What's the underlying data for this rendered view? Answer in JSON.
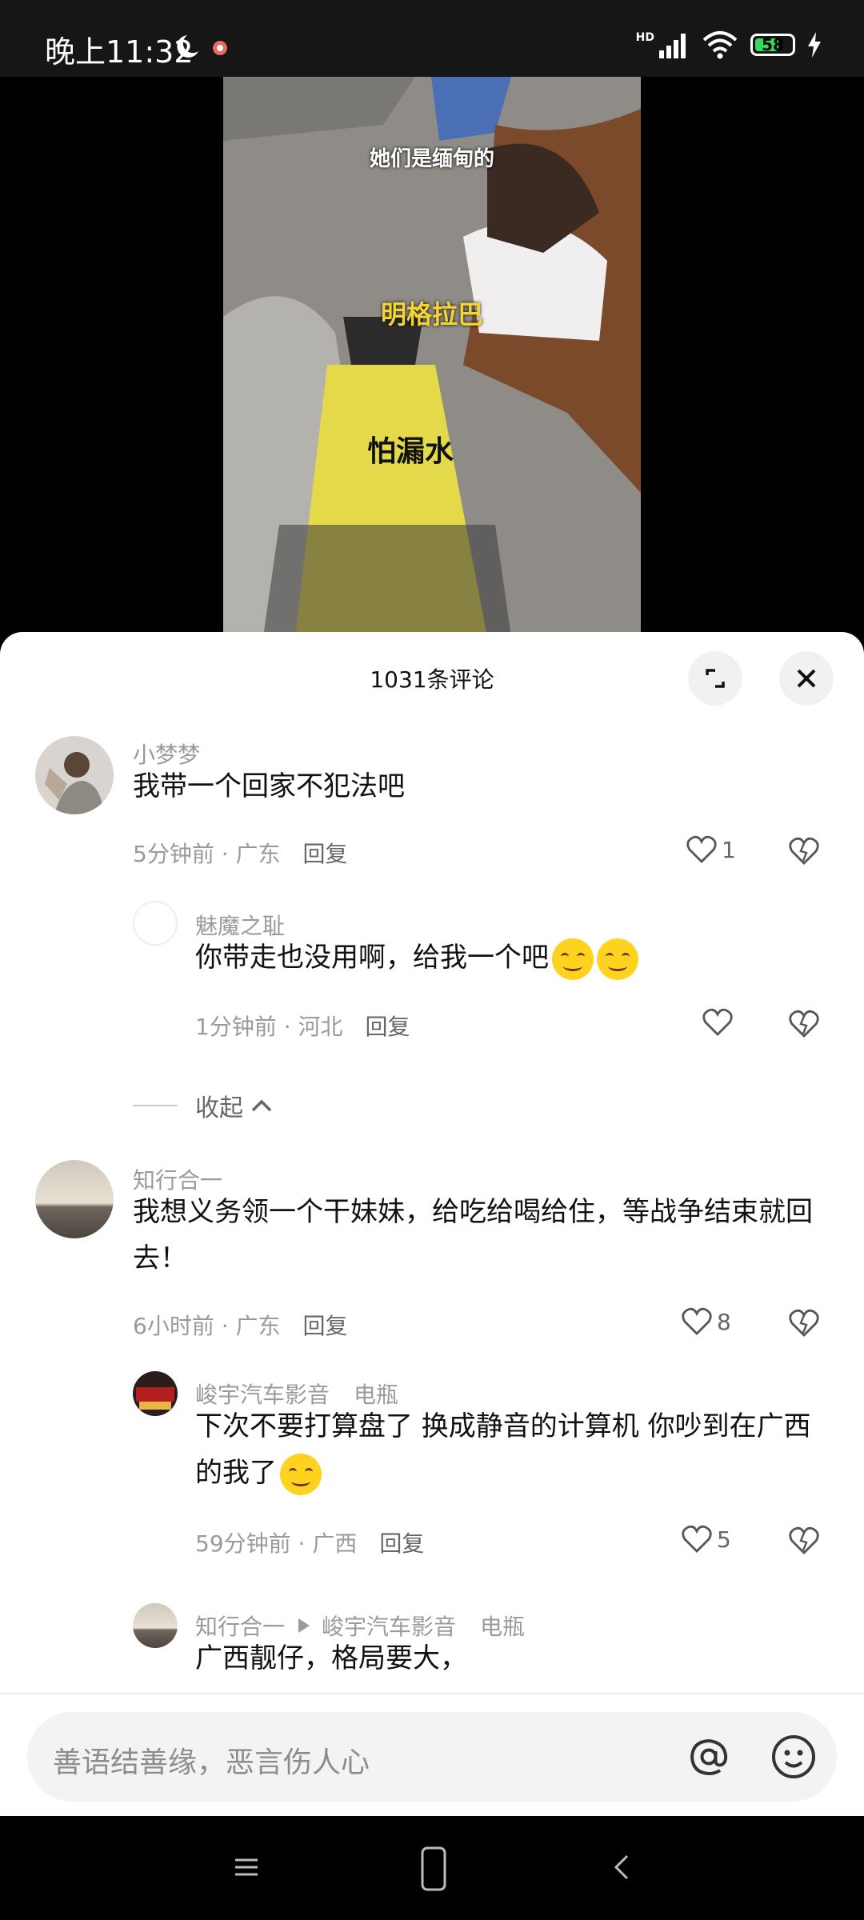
{
  "status": {
    "time": "晚上11:32",
    "network": "HD",
    "battery": "58"
  },
  "video": {
    "caption_top": "她们是缅甸的",
    "caption_mid": "明格拉巴",
    "sign_text": "怕漏水 就用荣德福"
  },
  "comments_header": {
    "title": "1031条评论"
  },
  "comments": [
    {
      "username": "小梦梦",
      "text": "我带一个回家不犯法吧",
      "time": "5分钟前",
      "location": "广东",
      "reply_label": "回复",
      "likes": "1"
    },
    {
      "username": "魅魔之耻",
      "text": "你带走也没用啊，给我一个吧",
      "time": "1分钟前",
      "location": "河北",
      "reply_label": "回复",
      "likes": ""
    },
    {
      "username": "知行合一",
      "text": "我想义务领一个干妹妹，给吃给喝给住，等战争结束就回去！",
      "time": "6小时前",
      "location": "广东",
      "reply_label": "回复",
      "likes": "8"
    },
    {
      "username": "峻宇汽车影音",
      "badge": "电瓶",
      "text": "下次不要打算盘了 换成静音的计算机   你吵到在广西的我了",
      "time": "59分钟前",
      "location": "广西",
      "reply_label": "回复",
      "likes": "5"
    },
    {
      "username": "知行合一",
      "reply_to": "峻宇汽车影音",
      "badge": "电瓶",
      "text": "广西靓仔，格局要大，",
      "time": "",
      "location": "",
      "reply_label": "",
      "likes": ""
    }
  ],
  "collapse_label": "收起",
  "input": {
    "placeholder": "善语结善缘，恶言伤人心"
  },
  "colors": {
    "accent_like": "#666666",
    "battery": "#3bd65a",
    "caption_yellow": "#f5d431"
  },
  "icons": [
    "moon-icon",
    "signal-icon",
    "wifi-icon",
    "battery-icon",
    "charging-icon",
    "expand-icon",
    "close-icon",
    "heart-icon",
    "broken-heart-icon",
    "at-icon",
    "emoji-icon",
    "menu-icon",
    "home-icon",
    "back-icon"
  ]
}
